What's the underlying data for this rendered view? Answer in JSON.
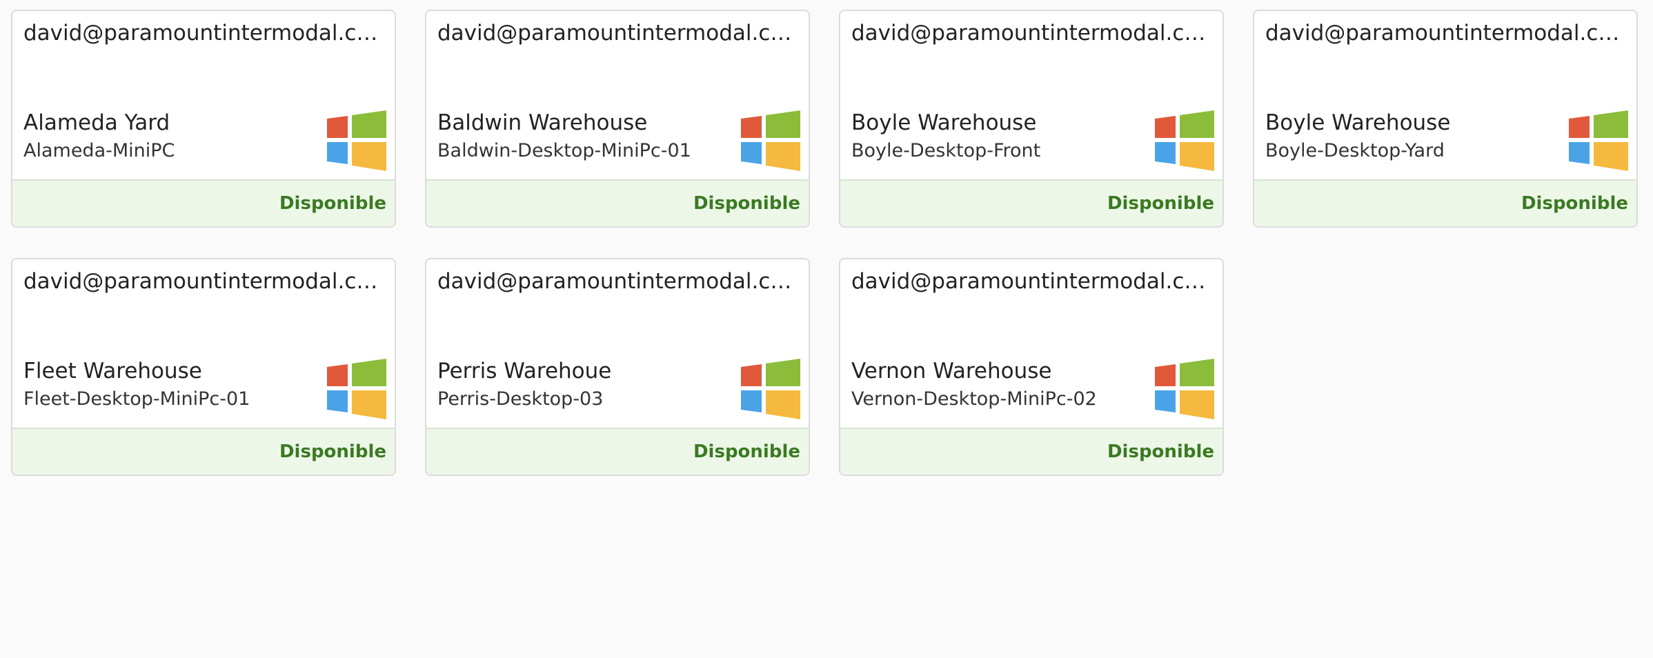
{
  "devices": [
    {
      "email": "david@paramountintermodal.com",
      "location": "Alameda Yard",
      "hostname": "Alameda-MiniPC",
      "os_icon": "windows-icon",
      "status": "Disponible"
    },
    {
      "email": "david@paramountintermodal.com",
      "location": "Baldwin Warehouse",
      "hostname": "Baldwin-Desktop-MiniPc-01",
      "os_icon": "windows-icon",
      "status": "Disponible"
    },
    {
      "email": "david@paramountintermodal.com",
      "location": "Boyle Warehouse",
      "hostname": "Boyle-Desktop-Front",
      "os_icon": "windows-icon",
      "status": "Disponible"
    },
    {
      "email": "david@paramountintermodal.com",
      "location": "Boyle Warehouse",
      "hostname": "Boyle-Desktop-Yard",
      "os_icon": "windows-icon",
      "status": "Disponible"
    },
    {
      "email": "david@paramountintermodal.com",
      "location": "Fleet Warehouse",
      "hostname": "Fleet-Desktop-MiniPc-01",
      "os_icon": "windows-icon",
      "status": "Disponible"
    },
    {
      "email": "david@paramountintermodal.com",
      "location": "Perris Warehoue",
      "hostname": "Perris-Desktop-03",
      "os_icon": "windows-icon",
      "status": "Disponible"
    },
    {
      "email": "david@paramountintermodal.com",
      "location": "Vernon Warehouse",
      "hostname": "Vernon-Desktop-MiniPc-02",
      "os_icon": "windows-icon",
      "status": "Disponible"
    }
  ],
  "colors": {
    "status_text": "#3a7a22",
    "status_bg": "#edf7e8",
    "win_red": "#e0593a",
    "win_green": "#8bbd3a",
    "win_blue": "#4aa3e6",
    "win_yellow": "#f5b93f"
  }
}
